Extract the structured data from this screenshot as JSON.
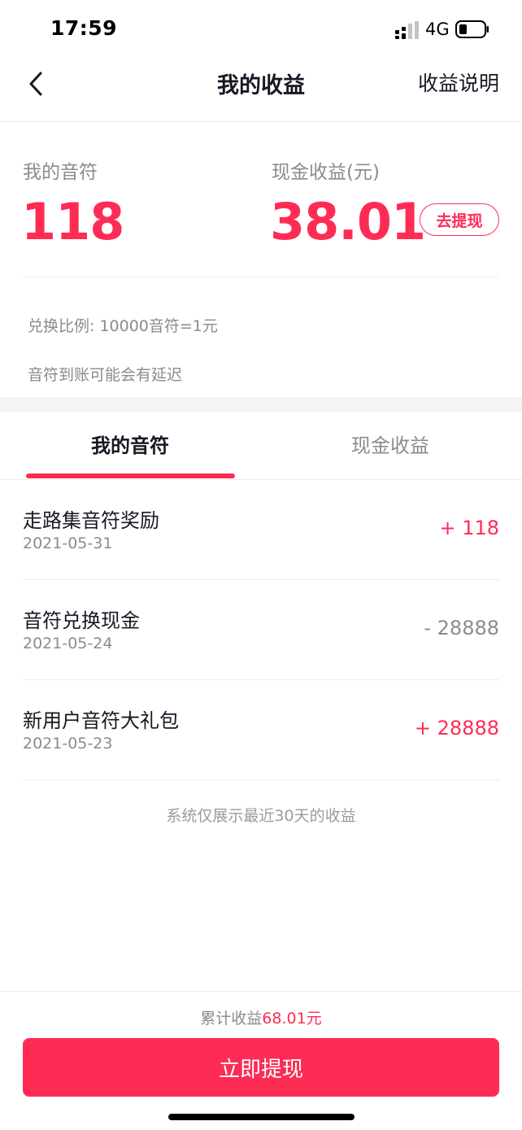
{
  "status_bar": {
    "time": "17:59",
    "network": "4G"
  },
  "nav": {
    "title": "我的收益",
    "right_link": "收益说明"
  },
  "summary": {
    "notes_label": "我的音符",
    "notes_value": "118",
    "cash_label": "现金收益(元)",
    "cash_value": "38.01",
    "withdraw_pill": "去提现",
    "exchange_rate": "兑换比例: 10000音符=1元",
    "delay_note": "音符到账可能会有延迟"
  },
  "tabs": [
    {
      "label": "我的音符",
      "active": true
    },
    {
      "label": "现金收益",
      "active": false
    }
  ],
  "records": [
    {
      "title": "走路集音符奖励",
      "date": "2021-05-31",
      "amount": "+ 118"
    },
    {
      "title": "音符兑换现金",
      "date": "2021-05-24",
      "amount": "- 28888"
    },
    {
      "title": "新用户音符大礼包",
      "date": "2021-05-23",
      "amount": "+ 28888"
    }
  ],
  "footer_note": "系统仅展示最近30天的收益",
  "bottom": {
    "total_prefix": "累计收益",
    "total_value": "68.01元",
    "withdraw_button": "立即提现"
  },
  "colors": {
    "accent": "#fe2c55",
    "text": "#161823",
    "secondary": "#8a8b91"
  },
  "icons": {
    "back": "chevron-left-icon",
    "signal": "signal-icon",
    "battery": "battery-icon"
  }
}
